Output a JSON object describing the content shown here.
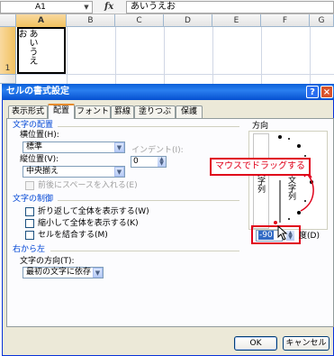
{
  "formula_bar": {
    "name_box": "A1",
    "fx": "fx",
    "value": "あいうえお"
  },
  "sheet": {
    "columns": [
      "A",
      "B",
      "C",
      "D",
      "E",
      "F",
      "G"
    ],
    "rows": [
      "1"
    ],
    "cell_a1": "あいうえお"
  },
  "dialog": {
    "title": "セルの書式設定",
    "tabs": [
      "表示形式",
      "配置",
      "フォント",
      "罫線",
      "塗りつぶし",
      "保護"
    ],
    "active_tab": "配置",
    "text_alignment": {
      "section": "文字の配置",
      "horizontal_label": "横位置(H):",
      "horizontal_value": "標準",
      "indent_label": "インデント(I):",
      "indent_value": "0",
      "vertical_label": "縦位置(V):",
      "vertical_value": "中央揃え",
      "distributed_label": "前後にスペースを入れる(E)"
    },
    "text_control": {
      "section": "文字の制御",
      "wrap": "折り返して全体を表示する(W)",
      "shrink": "縮小して全体を表示する(K)",
      "merge": "セルを結合する(M)"
    },
    "rtl": {
      "section": "右から左",
      "direction_label": "文字の方向(T):",
      "direction_value": "最初の文字に依存"
    },
    "orientation": {
      "section": "方向",
      "vertical_text": "文字列",
      "dial_text": "文字列",
      "degrees_value": "-90",
      "degrees_label": "度(D)"
    },
    "callout": "マウスでドラッグする",
    "ok": "OK",
    "cancel": "キャンセル"
  },
  "colors": {
    "accent": "#e0001a",
    "title_bar": "#0a5fd8",
    "section_text": "#0046d5"
  }
}
